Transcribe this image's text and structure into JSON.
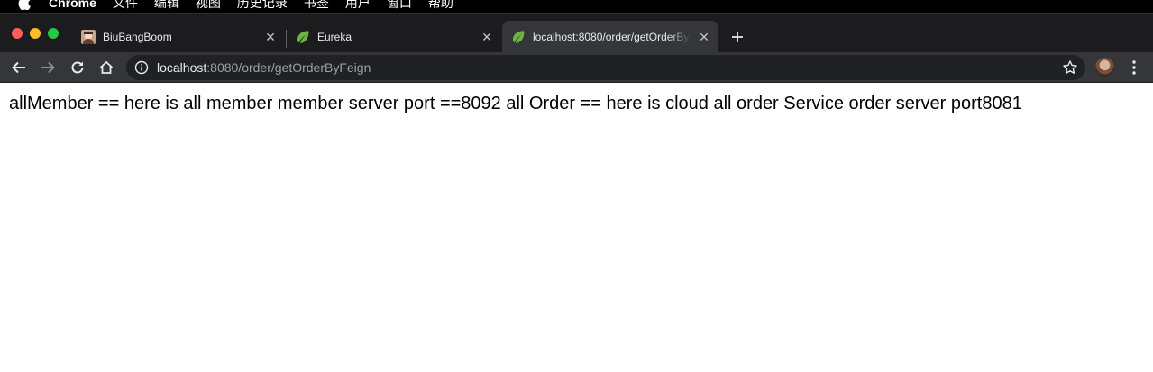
{
  "menubar": {
    "app_name": "Chrome",
    "items": [
      "文件",
      "编辑",
      "视图",
      "历史记录",
      "书签",
      "用户",
      "窗口",
      "帮助"
    ]
  },
  "tabs": [
    {
      "title": "BiuBangBoom",
      "favicon": "photo-favicon-icon",
      "active": false
    },
    {
      "title": "Eureka",
      "favicon": "spring-leaf-icon",
      "active": false
    },
    {
      "title": "localhost:8080/order/getOrderByFeign",
      "favicon": "spring-leaf-icon",
      "active": true
    }
  ],
  "toolbar": {
    "url_host": "localhost",
    "url_rest": ":8080/order/getOrderByFeign"
  },
  "page": {
    "body_text": "allMember == here is all member member server port ==8092 all Order == here is cloud all order Service order server port8081"
  },
  "colors": {
    "tabstrip_bg": "#1c1c1e",
    "toolbar_bg": "#35363a",
    "omnibox_bg": "#202124",
    "spring_green": "#6db33f"
  }
}
